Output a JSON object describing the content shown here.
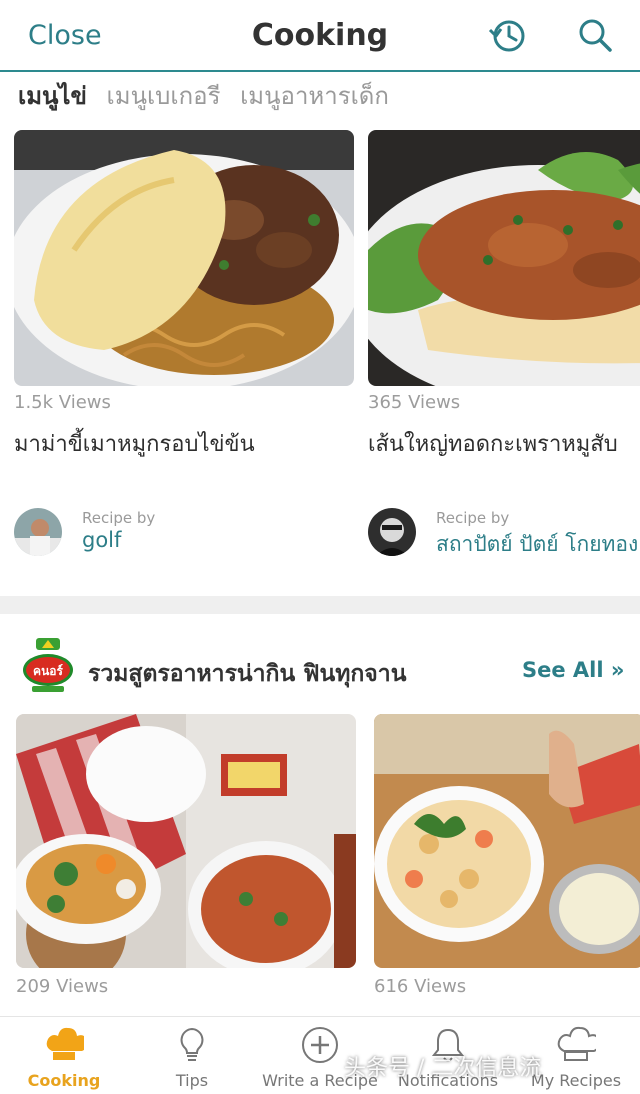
{
  "header": {
    "close_label": "Close",
    "title": "Cooking",
    "history_icon": "history-icon",
    "search_icon": "search-icon"
  },
  "tabs": [
    {
      "label": "เมนูไข่",
      "active": true
    },
    {
      "label": "เมนูเบเกอรี",
      "active": false
    },
    {
      "label": "เมนูอาหารเด็ก",
      "active": false
    }
  ],
  "recipes_top": [
    {
      "views": "1.5k Views",
      "name": "มาม่าขี้เมาหมูกรอบไข่ข้น",
      "recipe_by": "Recipe by",
      "author": "golf"
    },
    {
      "views": "365 Views",
      "name": "เส้นใหญ่ทอดกะเพราหมูสับ",
      "recipe_by": "Recipe by",
      "author": "สถาปัตย์ ปัตย์ โกยทอง"
    }
  ],
  "section": {
    "title": "รวมสูตรอาหารน่ากิน ฟินทุกจาน",
    "see_all": "See All »",
    "logo_text": "Knorr"
  },
  "recipes_bottom": [
    {
      "views": "209 Views"
    },
    {
      "views": "616 Views"
    }
  ],
  "bottom_nav": [
    {
      "label": "Cooking",
      "icon": "chef-hat-icon",
      "active": true
    },
    {
      "label": "Tips",
      "icon": "lightbulb-icon",
      "active": false
    },
    {
      "label": "Write a Recipe",
      "icon": "plus-circle-icon",
      "active": false
    },
    {
      "label": "Notifications",
      "icon": "bell-icon",
      "active": false
    },
    {
      "label": "My Recipes",
      "icon": "chef-hat-outline-icon",
      "active": false
    }
  ],
  "watermark": "头条号 / 二次信息流",
  "colors": {
    "accent": "#2d7e88",
    "active_nav": "#e8a31e",
    "divider": "#efefef"
  }
}
